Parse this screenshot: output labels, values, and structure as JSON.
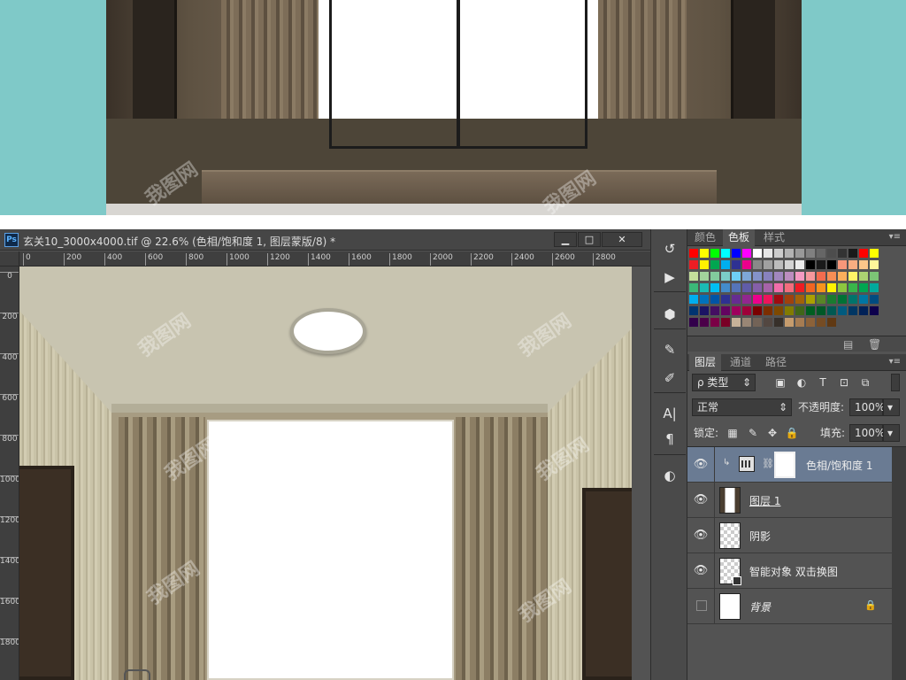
{
  "document": {
    "title": "玄关10_3000x4000.tif @ 22.6% (色相/饱和度 1, 图层蒙版/8) *",
    "ps_badge": "Ps",
    "window_buttons": {
      "minimize": "▁",
      "maximize": "□",
      "close": "✕"
    }
  },
  "ruler": {
    "horizontal": [
      "0",
      "200",
      "400",
      "600",
      "800",
      "1000",
      "1200",
      "1400",
      "1600",
      "1800",
      "2000",
      "2200",
      "2400",
      "2600",
      "2800"
    ],
    "vertical": [
      "0",
      "200",
      "400",
      "600",
      "800",
      "1000",
      "1200",
      "1400",
      "1600",
      "1800"
    ]
  },
  "watermark": "我图网",
  "tools": {
    "items": [
      {
        "name": "history-icon",
        "glyph": "↺"
      },
      {
        "name": "play-icon",
        "glyph": "▶"
      },
      {
        "name": "3d-icon",
        "glyph": "⬢"
      },
      {
        "name": "brush-settings-icon",
        "glyph": "✎"
      },
      {
        "name": "brush-presets-icon",
        "glyph": "✐"
      },
      {
        "name": "character-icon",
        "glyph": "A|"
      },
      {
        "name": "paragraph-icon",
        "glyph": "¶"
      },
      {
        "name": "adjustments-icon",
        "glyph": "◐"
      }
    ]
  },
  "swatches_panel": {
    "tabs": [
      {
        "label": "颜色",
        "active": false
      },
      {
        "label": "色板",
        "active": true
      },
      {
        "label": "样式",
        "active": false
      }
    ],
    "menu_glyph": "▾≡",
    "footer_icons": {
      "new": "▤",
      "delete": "🗑"
    },
    "colors": [
      [
        "#ff0000",
        "#ffff00",
        "#00ff00",
        "#00ffff",
        "#0000ff",
        "#ff00ff",
        "#ffffff",
        "#e6e6e6",
        "#cccccc",
        "#b3b3b3",
        "#999999",
        "#808080",
        "#666666",
        "#4d4d4d",
        "#333333",
        "#1a1a1a",
        "#ff0000",
        "#ffff00"
      ],
      [
        "#ee1d24",
        "#fff100",
        "#00a650",
        "#00aeef",
        "#2e3192",
        "#ec008c",
        "#898989",
        "#a0a0a0",
        "#bcbcbc",
        "#d3d3d3",
        "#ebebeb",
        "#000000",
        "#1a1a1a",
        "#000000",
        "#f7977a",
        "#f9ad81",
        "#fdc68a",
        "#fff79a"
      ],
      [
        "#c4df9b",
        "#a2d39c",
        "#82ca9d",
        "#7bcdc8",
        "#6ecff6",
        "#7ea7d8",
        "#8493ca",
        "#8882be",
        "#a187be",
        "#bc8dbf",
        "#f49ac2",
        "#f6989d",
        "#f26c4f",
        "#f68e55",
        "#fbaf5c",
        "#fff467",
        "#acd372",
        "#7cc576"
      ],
      [
        "#3bb878",
        "#1abbb4",
        "#00bff3",
        "#438ccb",
        "#5574b9",
        "#605ca8",
        "#855fa8",
        "#a763a8",
        "#f06ea9",
        "#f26d7d",
        "#ed1c24",
        "#f26522",
        "#f7941d",
        "#fff200",
        "#8dc63f",
        "#39b54a",
        "#00a651",
        "#00a99d"
      ],
      [
        "#00aeef",
        "#0072bc",
        "#0054a6",
        "#2e3192",
        "#662d91",
        "#92278f",
        "#ec008c",
        "#ed145b",
        "#9e0b0f",
        "#a0410d",
        "#a36209",
        "#aba000",
        "#598527",
        "#1a7b30",
        "#007236",
        "#00746b",
        "#0076a3",
        "#004b80"
      ],
      [
        "#003471",
        "#1b1464",
        "#440e62",
        "#630460",
        "#9e005d",
        "#9e0039",
        "#790000",
        "#7b2e00",
        "#7d4900",
        "#827b00",
        "#406618",
        "#005e20",
        "#005826",
        "#005952",
        "#005b7f",
        "#003663",
        "#002157",
        "#0d004c"
      ],
      [
        "#32004b",
        "#4b0049",
        "#7b0046",
        "#7a0026",
        "#c7b299",
        "#998675",
        "#736357",
        "#534741",
        "#37302a",
        "#c69c6d",
        "#a67c52",
        "#8c6239",
        "#754c24",
        "#603913"
      ]
    ]
  },
  "layers_panel": {
    "tabs": [
      {
        "label": "图层",
        "active": true
      },
      {
        "label": "通道",
        "active": false
      },
      {
        "label": "路径",
        "active": false
      }
    ],
    "filter": {
      "label": "ρ 类型",
      "caret": "⇕"
    },
    "filter_icons": {
      "pixel": "▣",
      "adjust": "◐",
      "type": "T",
      "shape": "⊡",
      "smart": "⧉"
    },
    "blend_mode": {
      "value": "正常",
      "caret": "⇕"
    },
    "opacity": {
      "label": "不透明度:",
      "value": "100%",
      "caret": "▾"
    },
    "lock": {
      "label": "锁定:",
      "icons": [
        "▦",
        "✎",
        "✥",
        "🔒"
      ]
    },
    "fill": {
      "label": "填充:",
      "value": "100%",
      "caret": "▾"
    },
    "layers": [
      {
        "name": "色相/饱和度 1",
        "visible": true,
        "selected": true,
        "kind": "adjustment"
      },
      {
        "name": "图层 1",
        "visible": true,
        "selected": false,
        "kind": "image"
      },
      {
        "name": "阴影",
        "visible": true,
        "selected": false,
        "kind": "transparent"
      },
      {
        "name": "智能对象 双击换图",
        "visible": true,
        "selected": false,
        "kind": "smart"
      },
      {
        "name": "背景",
        "visible": false,
        "selected": false,
        "kind": "background",
        "locked": true
      }
    ],
    "eye_glyph": "👁",
    "lock_glyph": "🔒"
  }
}
